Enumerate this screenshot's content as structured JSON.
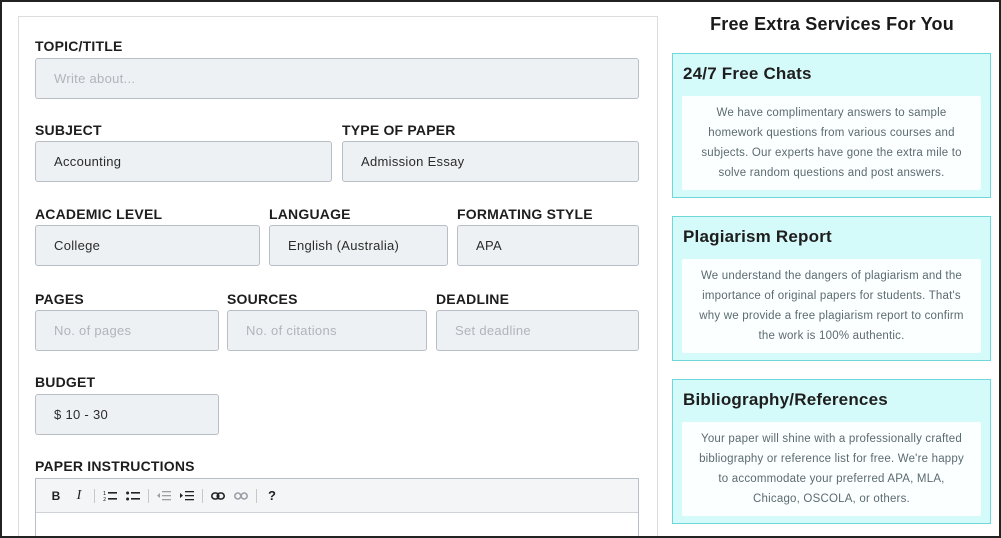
{
  "form": {
    "topic": {
      "label": "TOPIC/TITLE",
      "placeholder": "Write about..."
    },
    "subject": {
      "label": "SUBJECT",
      "value": "Accounting"
    },
    "type_of_paper": {
      "label": "TYPE OF PAPER",
      "value": "Admission Essay"
    },
    "academic_level": {
      "label": "ACADEMIC LEVEL",
      "value": "College"
    },
    "language": {
      "label": "LANGUAGE",
      "value": "English (Australia)"
    },
    "formatting_style": {
      "label": "FORMATING STYLE",
      "value": "APA"
    },
    "pages": {
      "label": "PAGES",
      "placeholder": "No. of pages"
    },
    "sources": {
      "label": "SOURCES",
      "placeholder": "No. of citations"
    },
    "deadline": {
      "label": "DEADLINE",
      "placeholder": "Set deadline"
    },
    "budget": {
      "label": "BUDGET",
      "value": "$ 10 - 30"
    },
    "instructions": {
      "label": "PAPER INSTRUCTIONS",
      "toolbar": {
        "bold": "B",
        "italic": "I",
        "help": "?",
        "icons": [
          "numbered-list-icon",
          "bulleted-list-icon",
          "outdent-icon",
          "indent-icon",
          "link-icon",
          "unlink-icon"
        ]
      }
    }
  },
  "services": {
    "title": "Free Extra Services For You",
    "cards": [
      {
        "title": "24/7 Free Chats",
        "body": "We have complimentary answers to sample homework questions from various courses and subjects. Our experts have gone the extra mile to solve random questions and post answers."
      },
      {
        "title": "Plagiarism Report",
        "body": "We understand the dangers of plagiarism and the importance of original papers for students. That's why we provide a free plagiarism report to confirm the work is 100% authentic."
      },
      {
        "title": "Bibliography/References",
        "body": "Your paper will shine with a professionally crafted bibliography or reference list for free. We're happy to accommodate your preferred APA, MLA, Chicago, OSCOLA, or others."
      }
    ]
  },
  "colors": {
    "card_background": "#d5fafa",
    "card_border": "#6fd7da",
    "field_background": "#eef1f4",
    "field_border": "#b8bec5"
  }
}
